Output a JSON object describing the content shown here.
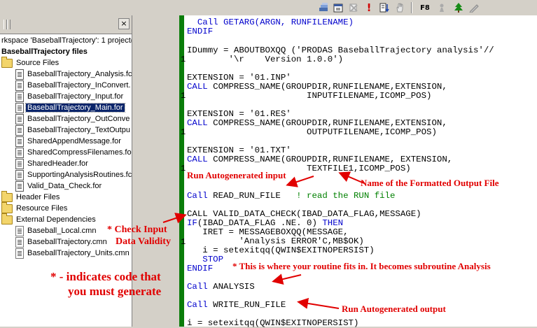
{
  "tree": {
    "workspace": "rkspace 'BaseballTrajectory': 1 project(",
    "project": "BaseballTrajectory files",
    "source_folder": "Source Files",
    "source_files": [
      "BaseballTrajectory_Analysis.fc",
      "BaseballTrajectory_InConvert.",
      "BaseballTrajectory_Input.for",
      "BaseballTrajectory_Main.for",
      "BaseballTrajectory_OutConve",
      "BaseballTrajectory_TextOutpu",
      "SharedAppendMessage.for",
      "SharedCompressFilenames.for",
      "SharedHeader.for",
      "SupportingAnalysisRoutines.fc",
      "Valid_Data_Check.for"
    ],
    "header_folder": "Header Files",
    "resource_folder": "Resource Files",
    "external_folder": "External Dependencies",
    "external_files": [
      "Baseball_Local.cmn",
      "BaseballTrajectory.cmn",
      "BaseballTrajectory_Units.cmn"
    ]
  },
  "code": {
    "l1": "  Call GETARG(ARGN, RUNFILENAME)",
    "l2": "ENDIF",
    "l3": "IDummy = ABOUTBOXQQ ('PRODAS BaseballTrajectory analysis'//",
    "l4": "        '\\r    Version 1.0.0')",
    "l5": "EXTENSION = '01.INP'",
    "l6a": "CALL",
    "l6b": " COMPRESS_NAME(GROUPDIR,RUNFILENAME,EXTENSION,",
    "l7": "                       INPUTFILENAME,ICOMP_POS)",
    "l8": "EXTENSION = '01.RES'",
    "l9a": "CALL",
    "l9b": " COMPRESS_NAME(GROUPDIR,RUNFILENAME,EXTENSION,",
    "l10": "                       OUTPUTFILENAME,ICOMP_POS)",
    "l11": "EXTENSION = '01.TXT'",
    "l12a": "CALL",
    "l12b": " COMPRESS_NAME(GROUPDIR,RUNFILENAME, EXTENSION,",
    "l13": "                       TEXTFILE1,ICOMP_POS)",
    "l14a": "Call",
    "l14b": " READ_RUN_FILE   ",
    "l14c": "! read the RUN file",
    "l15": "CALL VALID_DATA_CHECK(IBAD_DATA_FLAG,MESSAGE)",
    "l16a": "IF",
    "l16b": "(IBAD_DATA_FLAG .NE. 0) ",
    "l16c": "THEN",
    "l17": "   IRET = MESSAGEBOXQQ(MESSAGE,",
    "l18": "          'Analysis ERROR'C,MB$OK)",
    "l19": "   i = setexitqq(QWIN$EXITNOPERSIST)",
    "l20": "   STOP",
    "l21": "ENDIF",
    "l22a": "Call",
    "l22b": " ANALYSIS",
    "l23a": "Call",
    "l23b": " WRITE_RUN_FILE",
    "l24": "i = setexitqq(QWIN$EXITNOPERSIST)",
    "gutter_marks": [
      "1",
      "1",
      "1",
      "1",
      "1"
    ]
  },
  "annotations": {
    "run_input": "Run Autogenerated input",
    "formatted_output": "Name of the Formatted Output File",
    "check_input_1": "* Check Input",
    "check_input_2": "Data Validity",
    "indicates_1": "* - indicates code that",
    "indicates_2": "you must generate",
    "routine_fits": "* This is where your routine fits in.  It becomes subroutine Analysis",
    "run_output": "Run Autogenerated output"
  },
  "toolbar": {
    "f8_label": "F8"
  },
  "icons": [
    "save-all-icon",
    "calendar-icon",
    "delete-icon",
    "exclamation-icon",
    "step-icon",
    "hand-icon",
    "tree-icon",
    "pen-icon"
  ]
}
